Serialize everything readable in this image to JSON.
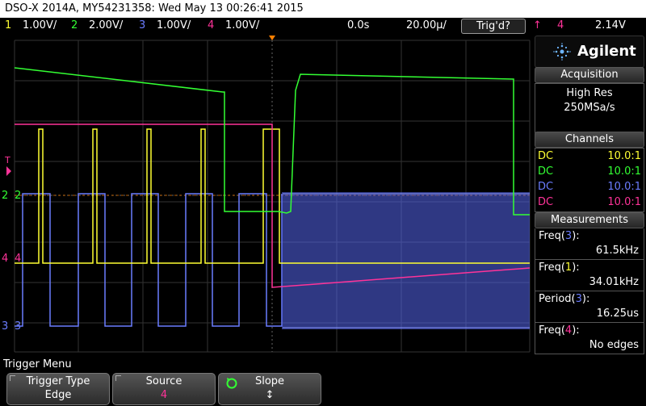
{
  "titlebar": {
    "text": "DSO-X 2014A, MY54231358: Wed May 13 00:26:41 2015"
  },
  "status": {
    "ch1_num": "1",
    "ch1_scale": "1.00V/",
    "ch2_num": "2",
    "ch2_scale": "2.00V/",
    "ch3_num": "3",
    "ch3_scale": "1.00V/",
    "ch4_num": "4",
    "ch4_scale": "1.00V/",
    "time_offset": "0.0s",
    "timebase": "20.00µ/",
    "trig_state": "Trig'd?",
    "trig_source": "4",
    "trig_level": "2.14V"
  },
  "colors": {
    "ch1": "#ffff33",
    "ch2": "#33ff33",
    "ch3": "#6b7dff",
    "ch4": "#ff3399",
    "grid": "#3a3a3a",
    "trigger_marker": "#ff8000"
  },
  "screen_markers": {
    "ch2": "2",
    "ch4": "4",
    "ch3": "3",
    "trig_level": "T"
  },
  "brand": {
    "name": "Agilent"
  },
  "acquisition": {
    "header": "Acquisition",
    "mode": "High Res",
    "rate": "250MSa/s"
  },
  "channels": {
    "header": "Channels",
    "rows": [
      {
        "coupling": "DC",
        "ratio": "10.0:1",
        "color": "#ffff33"
      },
      {
        "coupling": "DC",
        "ratio": "10.0:1",
        "color": "#33ff33"
      },
      {
        "coupling": "DC",
        "ratio": "10.0:1",
        "color": "#6b7dff"
      },
      {
        "coupling": "DC",
        "ratio": "10.0:1",
        "color": "#ff3399"
      }
    ]
  },
  "measurements": {
    "header": "Measurements",
    "items": [
      {
        "name": "Freq",
        "ch": "3",
        "value": "61.5kHz",
        "color": "#6b7dff"
      },
      {
        "name": "Freq",
        "ch": "1",
        "value": "34.01kHz",
        "color": "#ffff33"
      },
      {
        "name": "Period",
        "ch": "3",
        "value": "16.25us",
        "color": "#6b7dff"
      },
      {
        "name": "Freq",
        "ch": "4",
        "value": "No edges",
        "color": "#ff3399"
      }
    ]
  },
  "menu": {
    "title": "Trigger Menu",
    "keys": [
      {
        "top": "Trigger Type",
        "bottom": "Edge"
      },
      {
        "top": "Source",
        "bottom": "4"
      },
      {
        "top": "Slope",
        "bottom": "↕"
      }
    ]
  }
}
